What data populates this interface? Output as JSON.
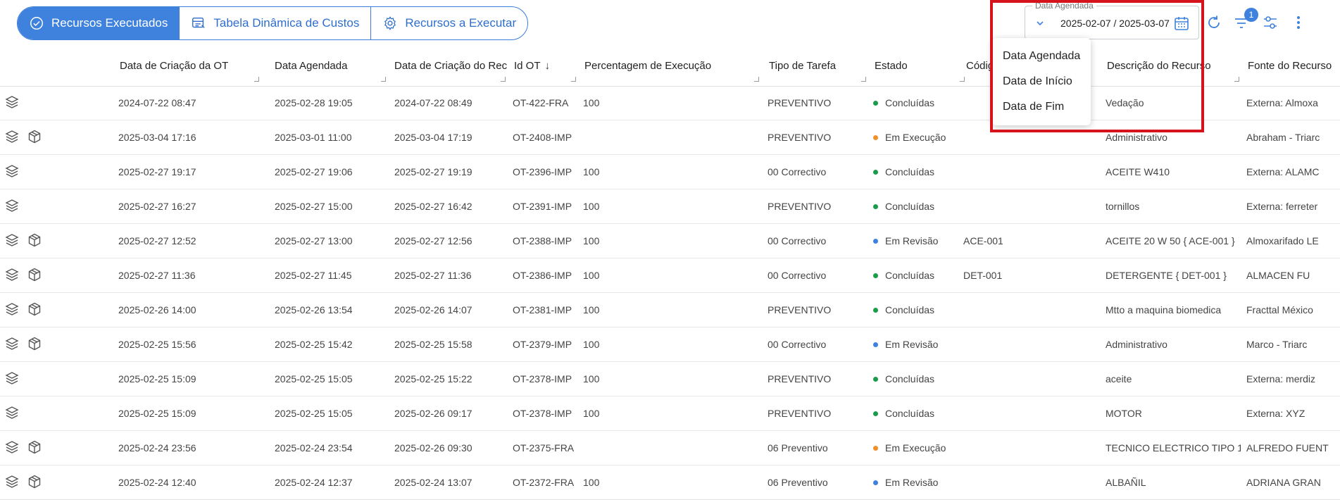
{
  "tabs": [
    {
      "label": "Recursos Executados",
      "icon": "check-circle-icon",
      "active": true
    },
    {
      "label": "Tabela Dinâmica de Custos",
      "icon": "table-icon",
      "active": false
    },
    {
      "label": "Recursos a Executar",
      "icon": "gear-icon",
      "active": false
    }
  ],
  "date_filter": {
    "label": "Data Agendada",
    "value": "2025-02-07 / 2025-03-07"
  },
  "filter_badge": "1",
  "dropdown": {
    "items": [
      "Data Agendada",
      "Data de Início",
      "Data de Fim"
    ]
  },
  "columns": [
    "Data de Criação da OT",
    "Data Agendada",
    "Data de Criação do Rec...",
    "Id OT",
    "Percentagem de Execução",
    "Tipo de Tarefa",
    "Estado",
    "Códig",
    "Descrição do Recurso",
    "Fonte do Recurso"
  ],
  "status_colors": {
    "Concluídas": "#1a9c4a",
    "Em Execução": "#f0902a",
    "Em Revisão": "#3e82de"
  },
  "rows": [
    {
      "box": false,
      "created": "2024-07-22 08:47",
      "scheduled": "2025-02-28 19:05",
      "rec_created": "2024-07-22 08:49",
      "id": "OT-422-FRA",
      "pct": "100",
      "type": "PREVENTIVO",
      "status": "Concluídas",
      "code": "",
      "desc": "Vedação",
      "source": "Externa: Almoxa"
    },
    {
      "box": true,
      "created": "2025-03-04 17:16",
      "scheduled": "2025-03-01 11:00",
      "rec_created": "2025-03-04 17:19",
      "id": "OT-2408-IMP",
      "pct": "",
      "type": "PREVENTIVO",
      "status": "Em Execução",
      "code": "",
      "desc": "Administrativo",
      "source": "Abraham - Triarc"
    },
    {
      "box": false,
      "created": "2025-02-27 19:17",
      "scheduled": "2025-02-27 19:06",
      "rec_created": "2025-02-27 19:19",
      "id": "OT-2396-IMP",
      "pct": "100",
      "type": "00 Correctivo",
      "status": "Concluídas",
      "code": "",
      "desc": "ACEITE W410",
      "source": "Externa: ALAMC"
    },
    {
      "box": false,
      "created": "2025-02-27 16:27",
      "scheduled": "2025-02-27 15:00",
      "rec_created": "2025-02-27 16:42",
      "id": "OT-2391-IMP",
      "pct": "100",
      "type": "PREVENTIVO",
      "status": "Concluídas",
      "code": "",
      "desc": "tornillos",
      "source": "Externa: ferreter"
    },
    {
      "box": true,
      "created": "2025-02-27 12:52",
      "scheduled": "2025-02-27 13:00",
      "rec_created": "2025-02-27 12:56",
      "id": "OT-2388-IMP",
      "pct": "100",
      "type": "00 Correctivo",
      "status": "Em Revisão",
      "code": "ACE-001",
      "desc": "ACEITE 20 W 50 { ACE-001 }",
      "source": "Almoxarifado LE"
    },
    {
      "box": true,
      "created": "2025-02-27 11:36",
      "scheduled": "2025-02-27 11:45",
      "rec_created": "2025-02-27 11:36",
      "id": "OT-2386-IMP",
      "pct": "100",
      "type": "00 Correctivo",
      "status": "Concluídas",
      "code": "DET-001",
      "desc": "DETERGENTE { DET-001 }",
      "source": "ALMACEN FU"
    },
    {
      "box": true,
      "created": "2025-02-26 14:00",
      "scheduled": "2025-02-26 13:54",
      "rec_created": "2025-02-26 14:07",
      "id": "OT-2381-IMP",
      "pct": "100",
      "type": "PREVENTIVO",
      "status": "Concluídas",
      "code": "",
      "desc": "Mtto a maquina biomedica",
      "source": "Fracttal México"
    },
    {
      "box": true,
      "created": "2025-02-25 15:56",
      "scheduled": "2025-02-25 15:42",
      "rec_created": "2025-02-25 15:58",
      "id": "OT-2379-IMP",
      "pct": "100",
      "type": "00 Correctivo",
      "status": "Em Revisão",
      "code": "",
      "desc": "Administrativo",
      "source": "Marco - Triarc"
    },
    {
      "box": false,
      "created": "2025-02-25 15:09",
      "scheduled": "2025-02-25 15:05",
      "rec_created": "2025-02-25 15:22",
      "id": "OT-2378-IMP",
      "pct": "100",
      "type": "PREVENTIVO",
      "status": "Concluídas",
      "code": "",
      "desc": "aceite",
      "source": "Externa: merdiz"
    },
    {
      "box": false,
      "created": "2025-02-25 15:09",
      "scheduled": "2025-02-25 15:05",
      "rec_created": "2025-02-26 09:17",
      "id": "OT-2378-IMP",
      "pct": "100",
      "type": "PREVENTIVO",
      "status": "Concluídas",
      "code": "",
      "desc": "MOTOR",
      "source": "Externa: XYZ"
    },
    {
      "box": true,
      "created": "2025-02-24 23:56",
      "scheduled": "2025-02-24 23:54",
      "rec_created": "2025-02-26 09:30",
      "id": "OT-2375-FRA",
      "pct": "",
      "type": "06 Preventivo",
      "status": "Em Execução",
      "code": "",
      "desc": "TECNICO ELECTRICO TIPO 1",
      "source": "ALFREDO FUENT"
    },
    {
      "box": true,
      "created": "2025-02-24 12:40",
      "scheduled": "2025-02-24 12:37",
      "rec_created": "2025-02-24 13:07",
      "id": "OT-2372-FRA",
      "pct": "100",
      "type": "06 Preventivo",
      "status": "Em Revisão",
      "code": "",
      "desc": "ALBAÑIL",
      "source": "ADRIANA GRAN"
    }
  ]
}
